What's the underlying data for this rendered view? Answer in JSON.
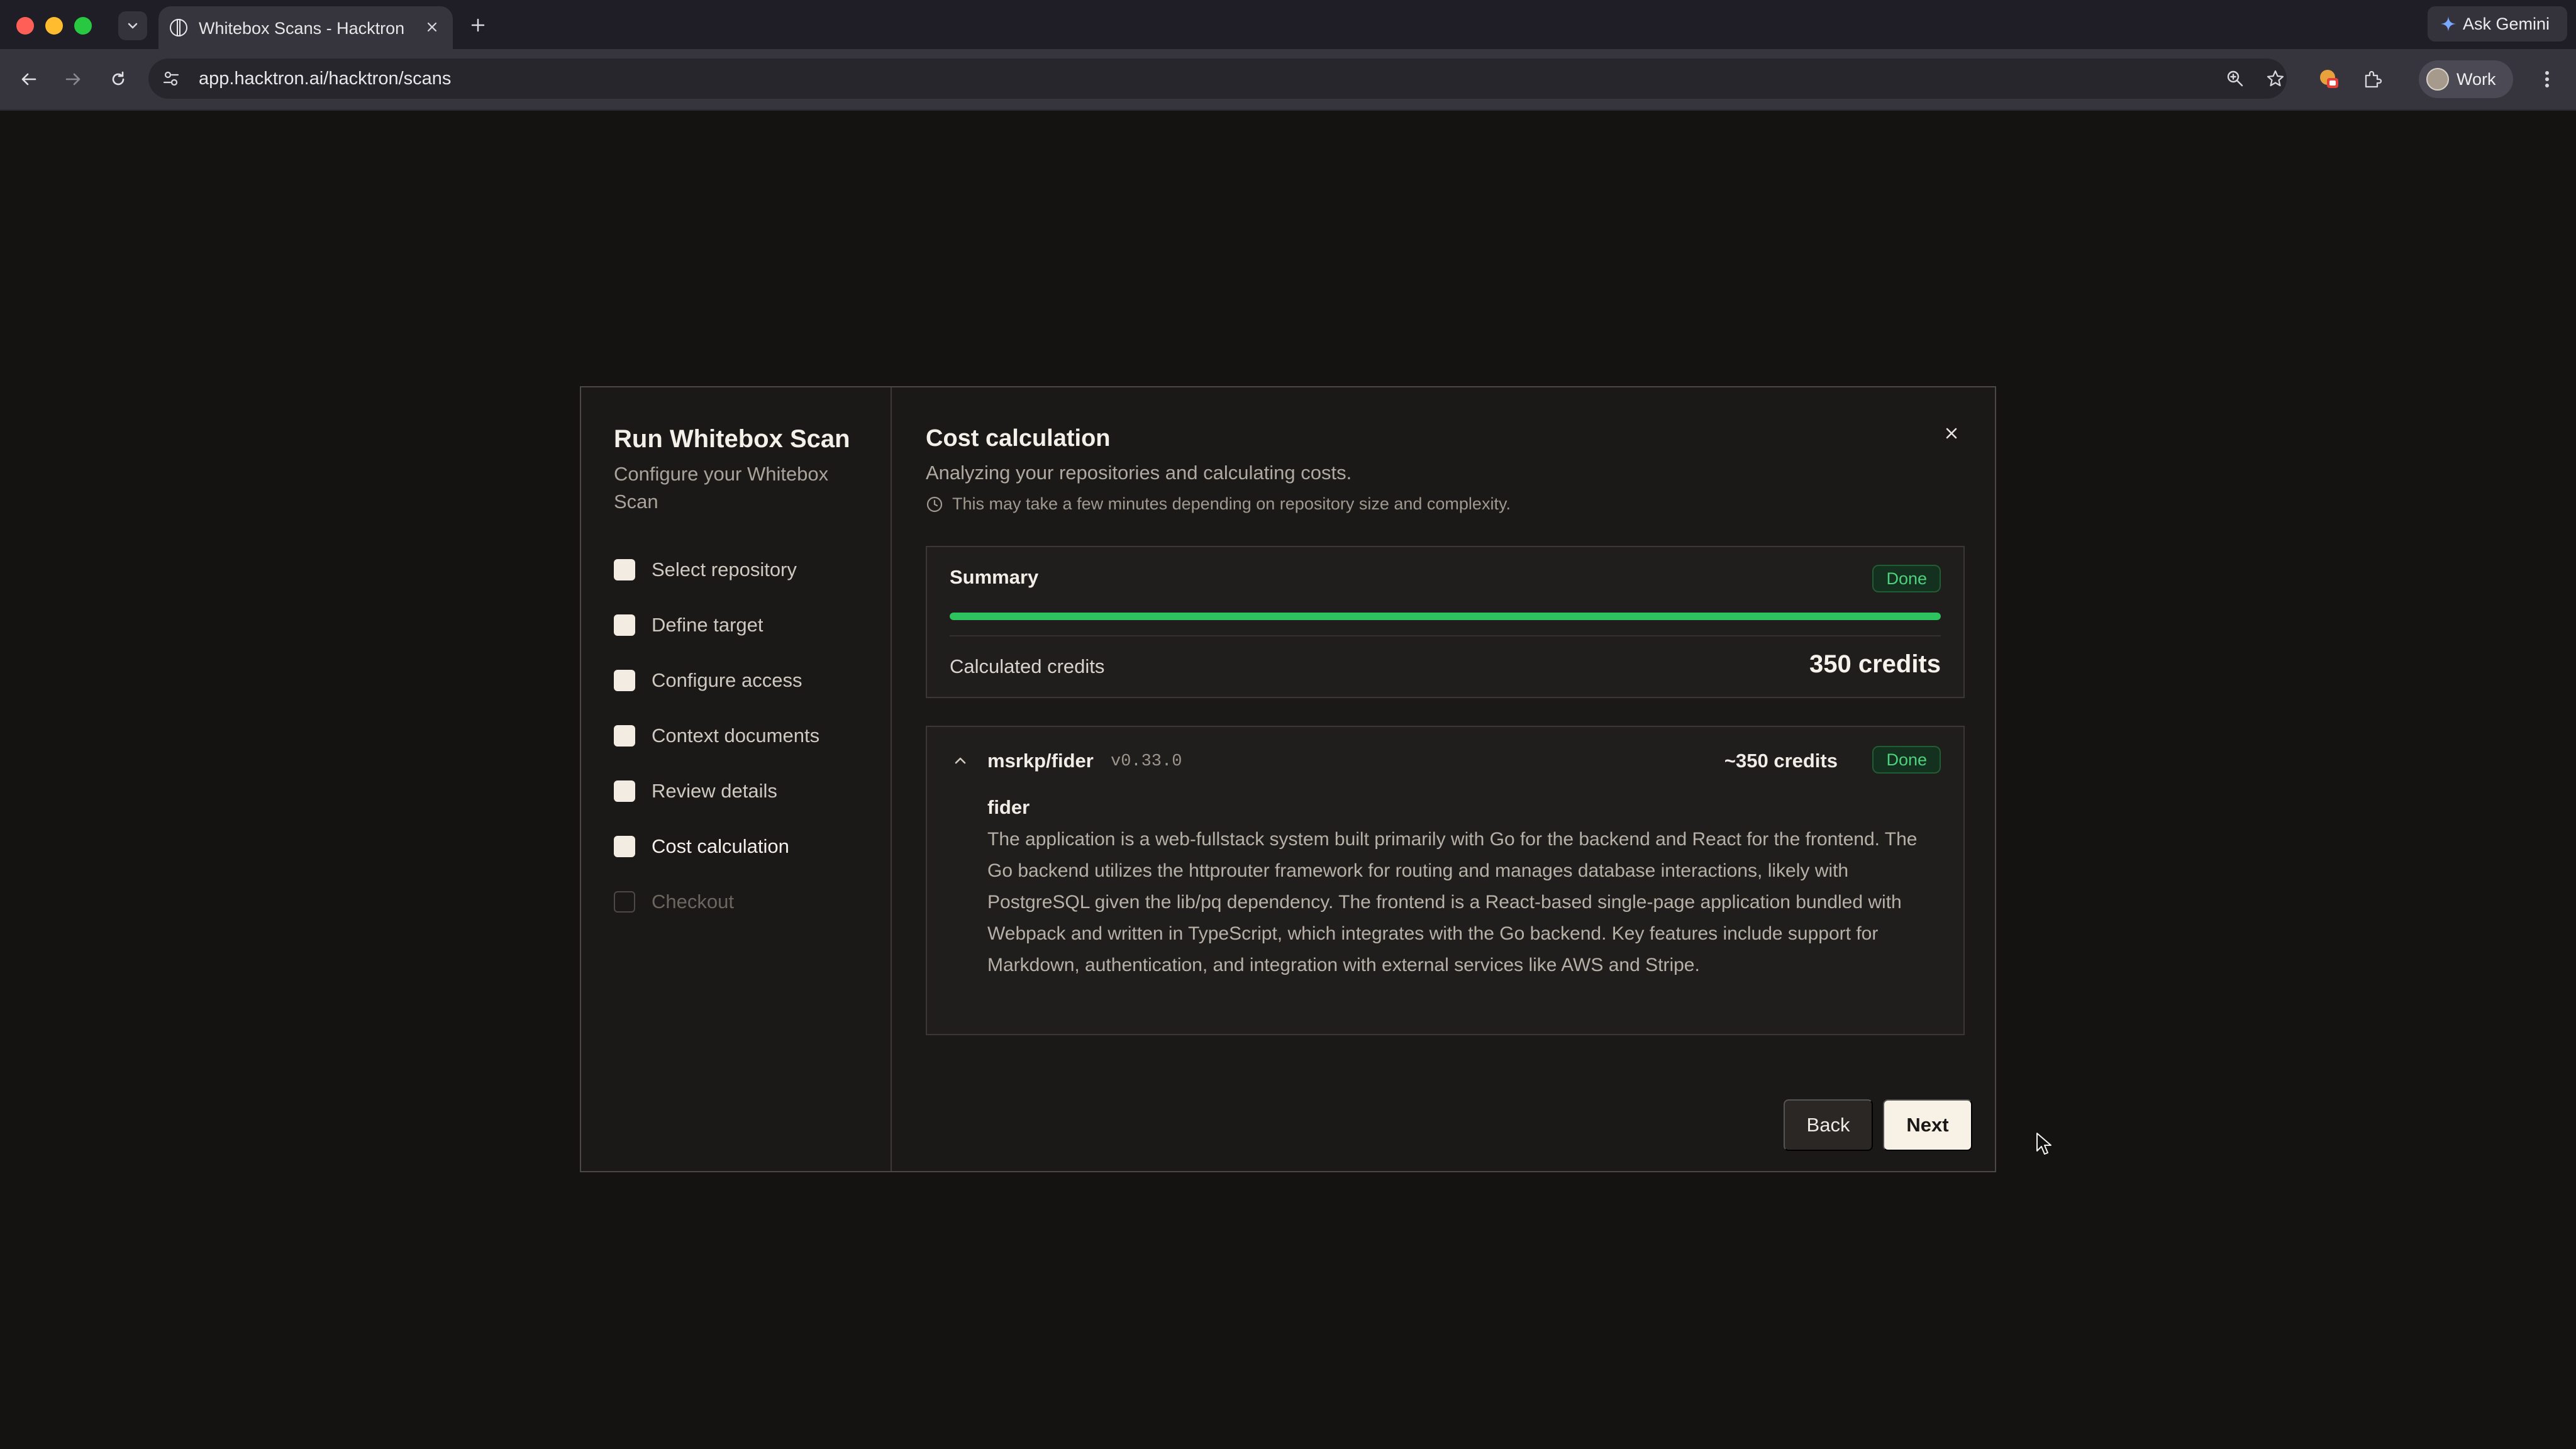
{
  "browser": {
    "tab_title": "Whitebox Scans - Hacktron",
    "url": "app.hacktron.ai/hacktron/scans",
    "ask_gemini": "Ask Gemini",
    "profile": "Work"
  },
  "sidebar": {
    "title": "Run Whitebox Scan",
    "subtitle": "Configure your Whitebox Scan",
    "steps": [
      {
        "label": "Select repository",
        "state": "complete"
      },
      {
        "label": "Define target",
        "state": "complete"
      },
      {
        "label": "Configure access",
        "state": "complete"
      },
      {
        "label": "Context documents",
        "state": "complete"
      },
      {
        "label": "Review details",
        "state": "complete"
      },
      {
        "label": "Cost calculation",
        "state": "current"
      },
      {
        "label": "Checkout",
        "state": "disabled"
      }
    ]
  },
  "main": {
    "title": "Cost calculation",
    "subtitle": "Analyzing your repositories and calculating costs.",
    "note": "This may take a few minutes depending on repository size and complexity.",
    "summary": {
      "title": "Summary",
      "status": "Done",
      "progress": 1.0,
      "credits_label": "Calculated credits",
      "credits_value": "350 credits"
    },
    "repo": {
      "name": "msrkp/fider",
      "version": "v0.33.0",
      "credits": "~350 credits",
      "status": "Done",
      "app_name": "fider",
      "description": "The application is a web-fullstack system built primarily with Go for the backend and React for the frontend. The Go backend utilizes the httprouter framework for routing and manages database interactions, likely with PostgreSQL given the lib/pq dependency. The frontend is a React-based single-page application bundled with Webpack and written in TypeScript, which integrates with the Go backend. Key features include support for Markdown, authentication, and integration with external services like AWS and Stripe."
    },
    "buttons": {
      "back": "Back",
      "next": "Next"
    }
  },
  "colors": {
    "accent_green": "#2dc45f",
    "badge_text": "#4ed17c",
    "next_button_bg": "#f7f1e6"
  }
}
